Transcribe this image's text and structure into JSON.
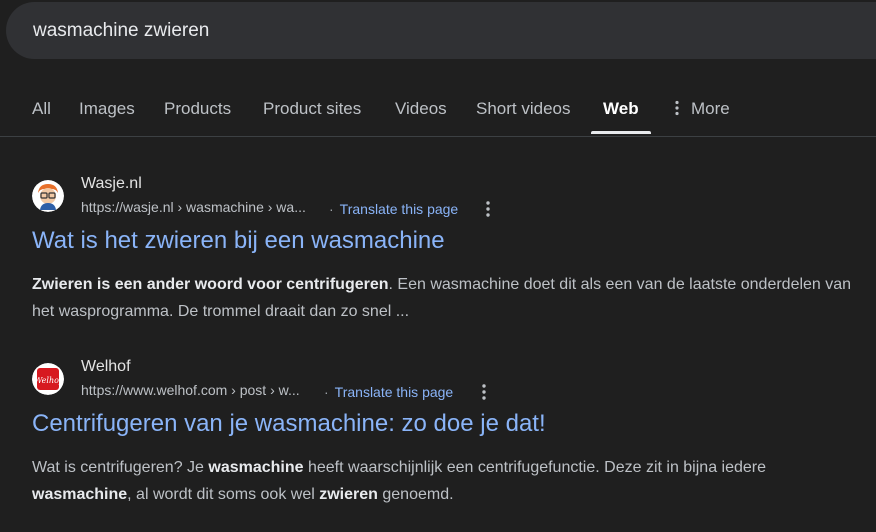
{
  "search": {
    "query": "wasmachine zwieren"
  },
  "tabs": [
    {
      "label": "All"
    },
    {
      "label": "Images"
    },
    {
      "label": "Products"
    },
    {
      "label": "Product sites"
    },
    {
      "label": "Videos"
    },
    {
      "label": "Short videos"
    },
    {
      "label": "Web",
      "active": true
    },
    {
      "label": "More"
    }
  ],
  "results": [
    {
      "site": "Wasje.nl",
      "url": "https://wasje.nl › wasmachine › wa...",
      "translate": "Translate this page",
      "title": "Wat is het zwieren bij een wasmachine",
      "snippet": [
        {
          "text": "Zwieren is een ander woord voor centrifugeren",
          "bold": true
        },
        {
          "text": ". Een wasmachine doet dit als een van de laatste onderdelen van het wasprogramma. De trommel draait dan zo snel ...",
          "bold": false
        }
      ]
    },
    {
      "site": "Welhof",
      "favicon_text": "Welhof",
      "url": "https://www.welhof.com › post › w...",
      "translate": "Translate this page",
      "title": "Centrifugeren van je wasmachine: zo doe je dat!",
      "snippet": [
        {
          "text": "Wat is centrifugeren? Je ",
          "bold": false
        },
        {
          "text": "wasmachine",
          "bold": true
        },
        {
          "text": " heeft waarschijnlijk een centrifugefunctie. Deze zit in bijna iedere ",
          "bold": false
        },
        {
          "text": "wasmachine",
          "bold": true
        },
        {
          "text": ", al wordt dit soms ook wel ",
          "bold": false
        },
        {
          "text": "zwieren",
          "bold": true
        },
        {
          "text": " genoemd.",
          "bold": false
        }
      ]
    }
  ],
  "colors": {
    "background": "#1f1f1f",
    "link": "#8ab4f8",
    "searchbox": "#303134"
  }
}
